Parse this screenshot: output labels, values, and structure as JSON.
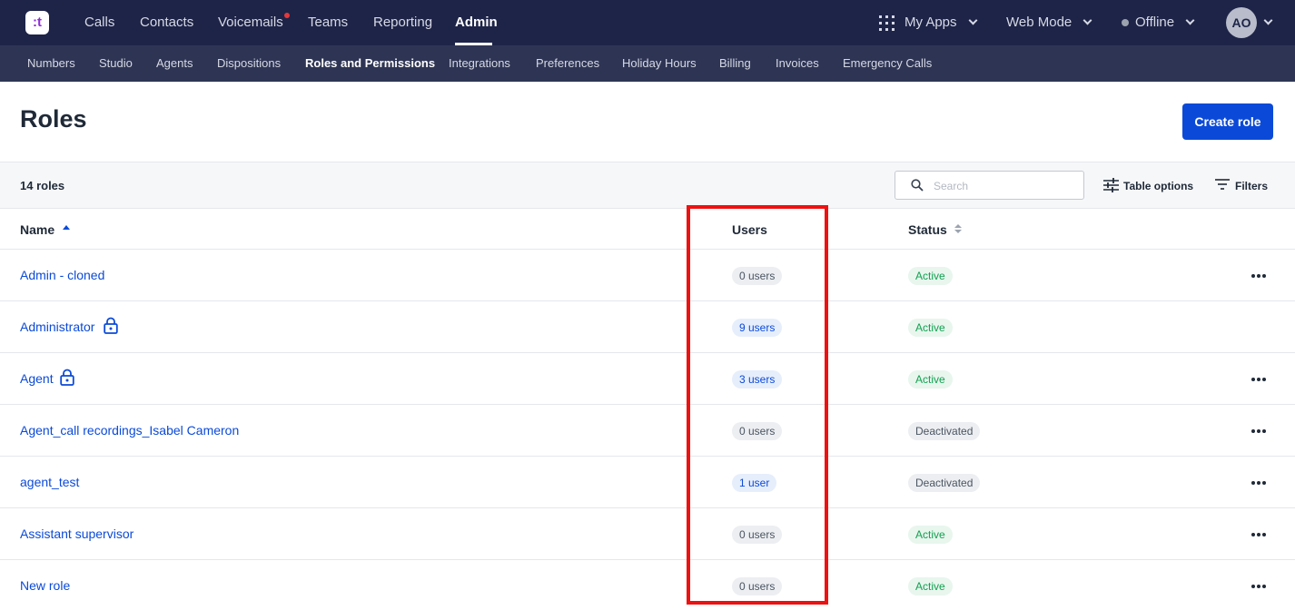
{
  "topnav": {
    "logo_mark": ":t",
    "items": [
      {
        "label": "Calls"
      },
      {
        "label": "Contacts"
      },
      {
        "label": "Voicemails"
      },
      {
        "label": "Teams"
      },
      {
        "label": "Reporting"
      },
      {
        "label": "Admin"
      }
    ],
    "active": "Admin",
    "right": {
      "my_apps": "My Apps",
      "web_mode": "Web Mode",
      "status": "Offline",
      "avatar": "AO"
    }
  },
  "subnav": {
    "items": [
      {
        "label": "Numbers"
      },
      {
        "label": "Studio"
      },
      {
        "label": "Agents"
      },
      {
        "label": "Dispositions"
      },
      {
        "label": "Roles and Permissions"
      },
      {
        "label": "Integrations"
      },
      {
        "label": "Preferences"
      },
      {
        "label": "Holiday Hours"
      },
      {
        "label": "Billing"
      },
      {
        "label": "Invoices"
      },
      {
        "label": "Emergency Calls"
      }
    ],
    "active": "Roles and Permissions"
  },
  "page": {
    "title": "Roles",
    "create_button": "Create role"
  },
  "toolbar": {
    "count": "14 roles",
    "search_placeholder": "Search",
    "table_options": "Table options",
    "filters": "Filters"
  },
  "table": {
    "headers": {
      "name": "Name",
      "users": "Users",
      "status": "Status"
    },
    "rows": [
      {
        "name": "Admin - cloned",
        "locked": false,
        "users": "0 users",
        "status": "Active",
        "has_menu": true
      },
      {
        "name": "Administrator",
        "locked": true,
        "users": "9 users",
        "status": "Active",
        "has_menu": false
      },
      {
        "name": "Agent",
        "locked": true,
        "users": "3 users",
        "status": "Active",
        "has_menu": true
      },
      {
        "name": "Agent_call recordings_Isabel Cameron",
        "locked": false,
        "users": "0 users",
        "status": "Deactivated",
        "has_menu": true
      },
      {
        "name": "agent_test",
        "locked": false,
        "users": "1 user",
        "status": "Deactivated",
        "has_menu": true
      },
      {
        "name": "Assistant supervisor",
        "locked": false,
        "users": "0 users",
        "status": "Active",
        "has_menu": true
      },
      {
        "name": "New role",
        "locked": false,
        "users": "0 users",
        "status": "Active",
        "has_menu": true
      }
    ]
  },
  "colors": {
    "nav_bg": "#1e2447",
    "subnav_bg": "#2e3554",
    "accent": "#0b4ad8",
    "active_green": "#12a150",
    "highlight": "#ee1111"
  }
}
